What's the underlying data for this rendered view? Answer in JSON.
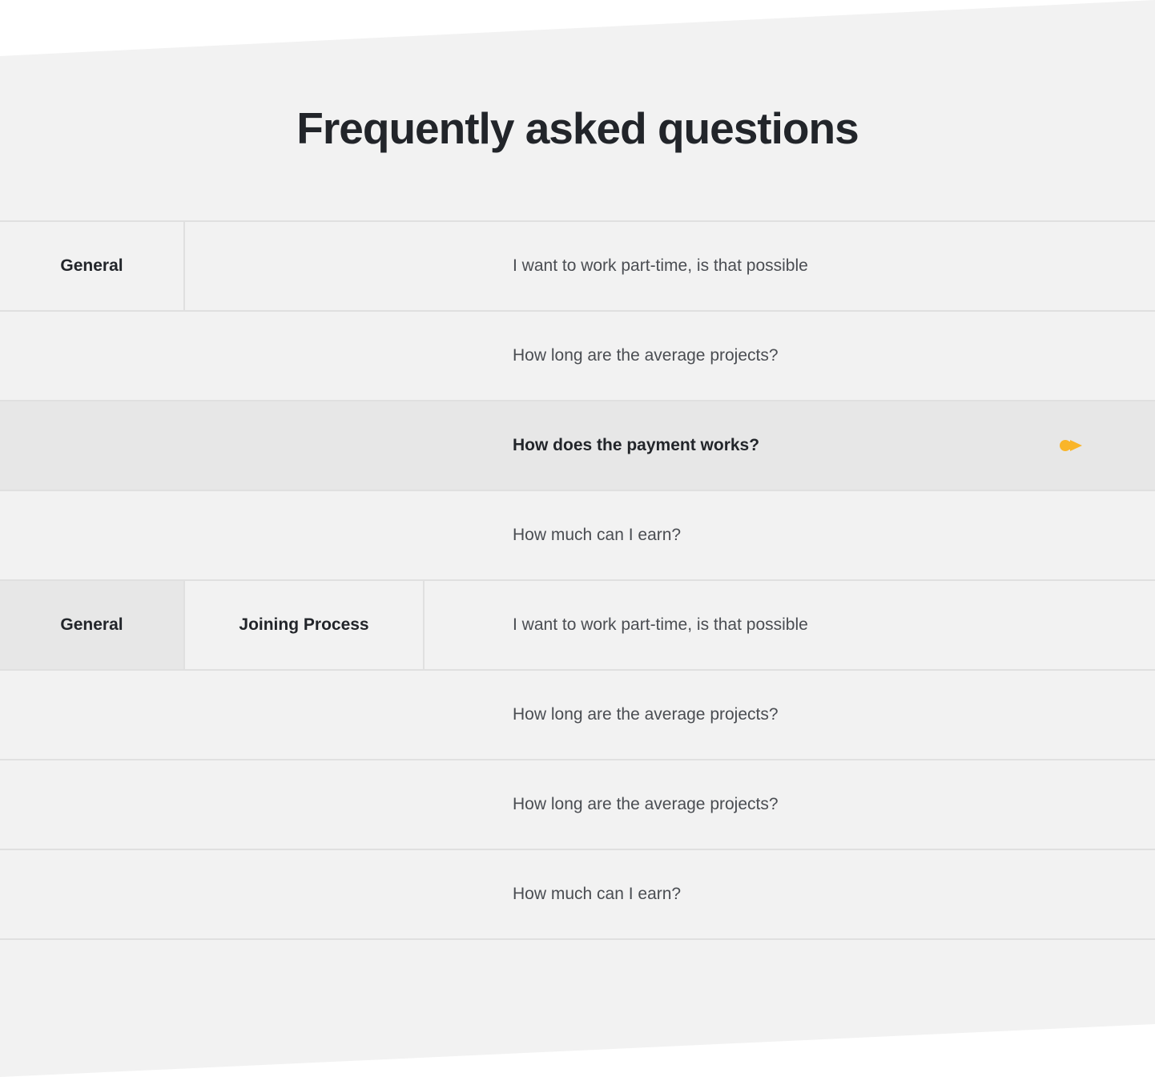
{
  "title": "Frequently asked questions",
  "colors": {
    "background": "#f2f2f2",
    "active_row": "#e7e7e7",
    "accent": "#f9b52a",
    "divider": "#e0e0e0",
    "text_dark": "#22252a",
    "text_muted": "#4a4d52"
  },
  "tabs_group_1": {
    "general": "General"
  },
  "tabs_group_2": {
    "general": "General",
    "joining": "Joining Process"
  },
  "questions": [
    {
      "text": "I want to work part-time, is that possible",
      "active": false
    },
    {
      "text": "How long are the average projects?",
      "active": false
    },
    {
      "text": "How does the payment works?",
      "active": true,
      "icon": "arrow-right-icon"
    },
    {
      "text": "How much can I earn?",
      "active": false
    },
    {
      "text": "I want to work part-time, is that possible",
      "active": false
    },
    {
      "text": "How long are the average projects?",
      "active": false
    },
    {
      "text": "How long are the average projects?",
      "active": false
    },
    {
      "text": "How much can I earn?",
      "active": false
    }
  ]
}
